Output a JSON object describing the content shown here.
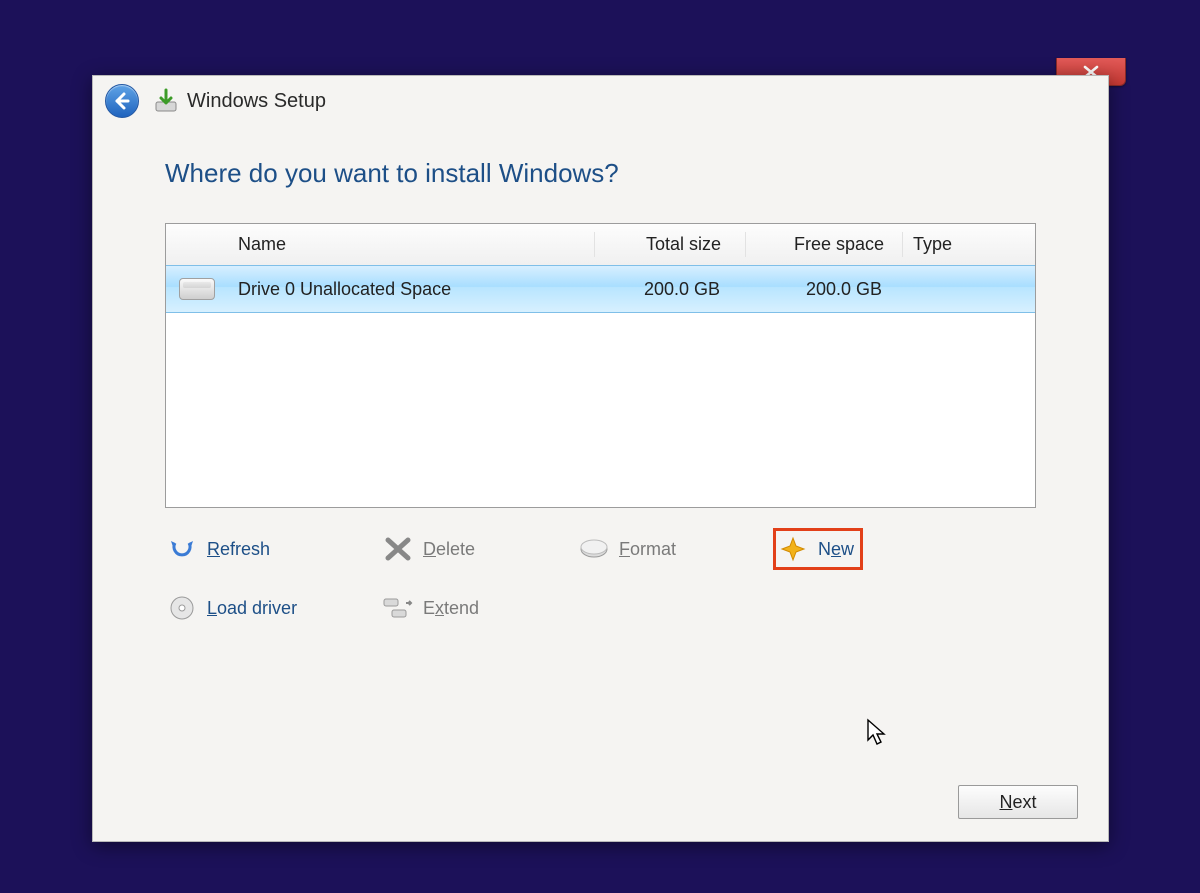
{
  "window": {
    "title": "Windows Setup"
  },
  "page": {
    "heading": "Where do you want to install Windows?"
  },
  "table": {
    "headers": {
      "name": "Name",
      "total": "Total size",
      "free": "Free space",
      "type": "Type"
    },
    "rows": [
      {
        "name": "Drive 0 Unallocated Space",
        "total": "200.0 GB",
        "free": "200.0 GB",
        "type": ""
      }
    ]
  },
  "tools": {
    "refresh": "Refresh",
    "delete": "Delete",
    "format": "Format",
    "new": "New",
    "load_driver": "Load driver",
    "extend": "Extend"
  },
  "buttons": {
    "next": "Next"
  }
}
